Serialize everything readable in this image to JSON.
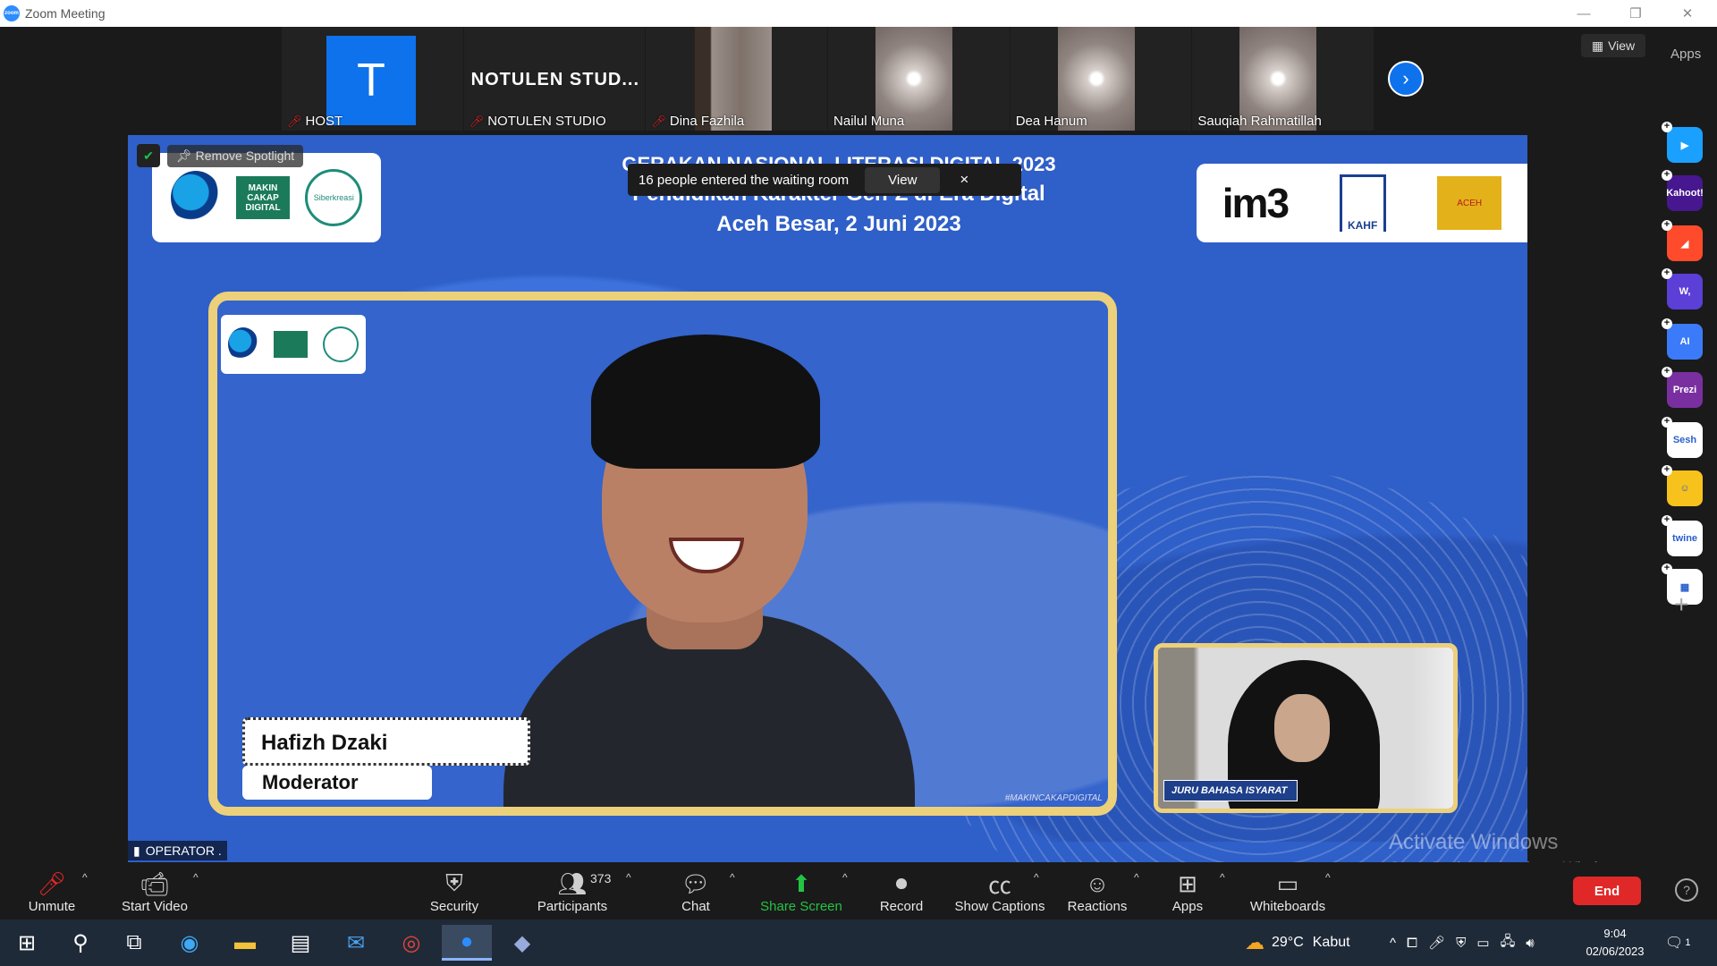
{
  "window": {
    "title": "Zoom Meeting"
  },
  "participants_strip": [
    {
      "name": "HOST",
      "display": "T",
      "muted": true
    },
    {
      "name": "NOTULEN STUDIO",
      "display": "NOTULEN  STUD...",
      "muted": true
    },
    {
      "name": "Dina Fazhila",
      "muted": true
    },
    {
      "name": "Nailul Muna",
      "muted": false
    },
    {
      "name": "Dea Hanum",
      "muted": false
    },
    {
      "name": "Sauqiah Rahmatillah",
      "muted": false
    }
  ],
  "top_right": {
    "view_label": "View",
    "apps_label": "Apps"
  },
  "apps_rail": [
    {
      "name": "app-1",
      "label": "▶",
      "color": "#1aa0ff"
    },
    {
      "name": "kahoot",
      "label": "Kahoot!",
      "color": "#46178f"
    },
    {
      "name": "app-3",
      "label": "◢",
      "color": "#ff4b2b"
    },
    {
      "name": "wooclap",
      "label": "W,",
      "color": "#5b3fd6"
    },
    {
      "name": "ai-app",
      "label": "AI",
      "color": "#3b7bfa"
    },
    {
      "name": "prezi",
      "label": "Prezi",
      "color": "#7a2fa0"
    },
    {
      "name": "sesh",
      "label": "Sesh",
      "color": "#ffffff"
    },
    {
      "name": "emoji-app",
      "label": "☺",
      "color": "#f7c21b"
    },
    {
      "name": "twine",
      "label": "twine",
      "color": "#ffffff"
    },
    {
      "name": "app-10",
      "label": "▦",
      "color": "#ffffff"
    }
  ],
  "share": {
    "headline_line1": "GERAKAN NASIONAL LITERASI DIGITAL 2023",
    "headline_line2": "Pendidikan Karakter Gen-Z di Era Digital",
    "headline_line3": "Aceh Besar, 2  Juni 2023",
    "logo_left_1": "KOMINFO",
    "logo_left_2": "MAKIN CAKAP DIGITAL",
    "logo_left_3": "Siberkreasi",
    "logo_right_1": "im3",
    "logo_right_2": "KAHF",
    "logo_right_3": "ACEH",
    "notification": "16 people entered the waiting room",
    "notification_view": "View",
    "notification_close": "×",
    "remove_spotlight": "Remove Spotlight",
    "speaker_name": "Hafizh Dzaki",
    "speaker_role": "Moderator",
    "frame_watermark": "#MAKINCAKAPDIGITAL",
    "interpreter_caption": "JURU BAHASA ISYARAT",
    "operator_label": "OPERATOR ."
  },
  "watermark": {
    "line1": "Activate Windows",
    "line2": "Go to Settings to activate Windows."
  },
  "toolbar": {
    "unmute": "Unmute",
    "start_video": "Start Video",
    "security": "Security",
    "participants": "Participants",
    "participants_count": "373",
    "chat": "Chat",
    "share_screen": "Share Screen",
    "record": "Record",
    "show_captions": "Show Captions",
    "reactions": "Reactions",
    "apps": "Apps",
    "whiteboards": "Whiteboards",
    "end": "End"
  },
  "taskbar": {
    "weather_temp": "29°C",
    "weather_desc": "Kabut",
    "time": "9:04",
    "date": "02/06/2023",
    "notifications": "1"
  }
}
